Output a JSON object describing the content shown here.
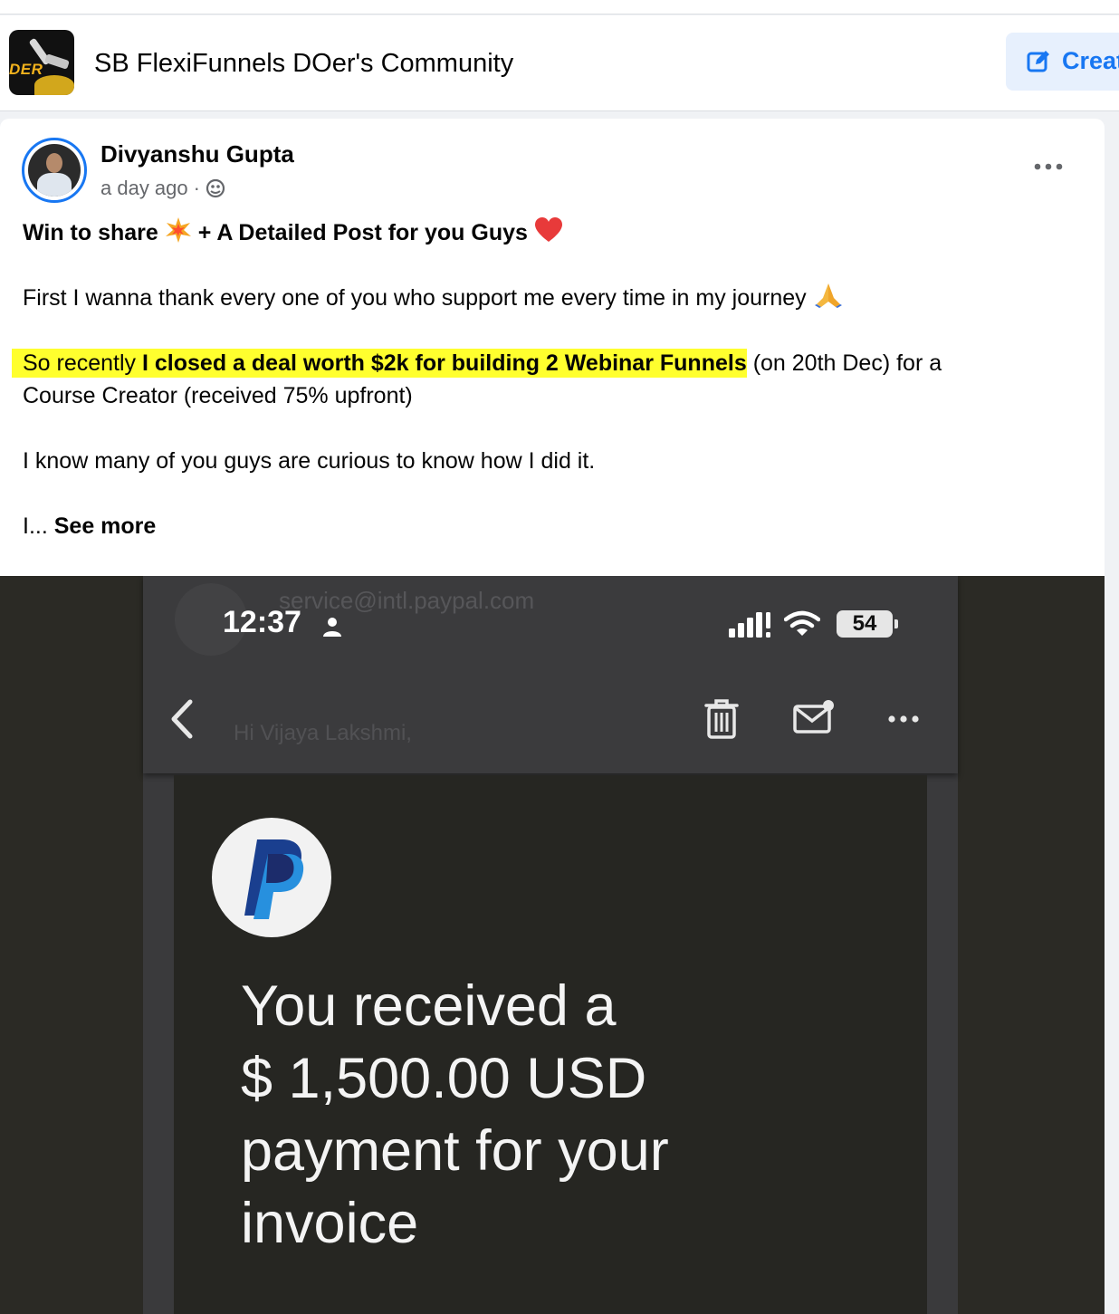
{
  "group": {
    "name": "SB FlexiFunnels DOer's Community",
    "logo_text": "DER",
    "create_label": "Creat"
  },
  "post": {
    "author": "Divyanshu Gupta",
    "time": "a day ago",
    "separator": "·",
    "line1_a": "Win to share",
    "line1_b": "+ A Detailed Post for you Guys",
    "line2": "First I wanna thank every one of you who support me every time in my journey",
    "line3_plain": "So recently",
    "line3_bold": "I closed a deal worth $2k for building 2 Webinar Funnels",
    "line3_rest": "(on 20th Dec) for a",
    "line4": "Course Creator (received 75% upfront)",
    "line5": "I know many of you guys are curious to know how I did it.",
    "line6_prefix": "I...",
    "see_more": "See more"
  },
  "screenshot": {
    "time": "12:37",
    "battery": "54",
    "ghost_sender": "service@intl.paypal.com",
    "ghost_greeting": "Hi Vijaya Lakshmi,",
    "payment_line1": "You received a",
    "payment_line2": "$ 1,500.00 USD",
    "payment_line3": "payment for your",
    "payment_line4": "invoice"
  },
  "colors": {
    "accent": "#1877f2",
    "highlight": "#ffff2e",
    "media_bg": "#2b2a25"
  },
  "icons": [
    "group-logo",
    "edit-icon",
    "globe-icon",
    "more-horizontal-icon",
    "collision-emoji",
    "heart-emoji",
    "praying-hands-emoji",
    "paypal-logo",
    "trash-icon",
    "mail-icon",
    "back-chevron-icon",
    "wifi-icon",
    "signal-icon",
    "person-icon"
  ]
}
